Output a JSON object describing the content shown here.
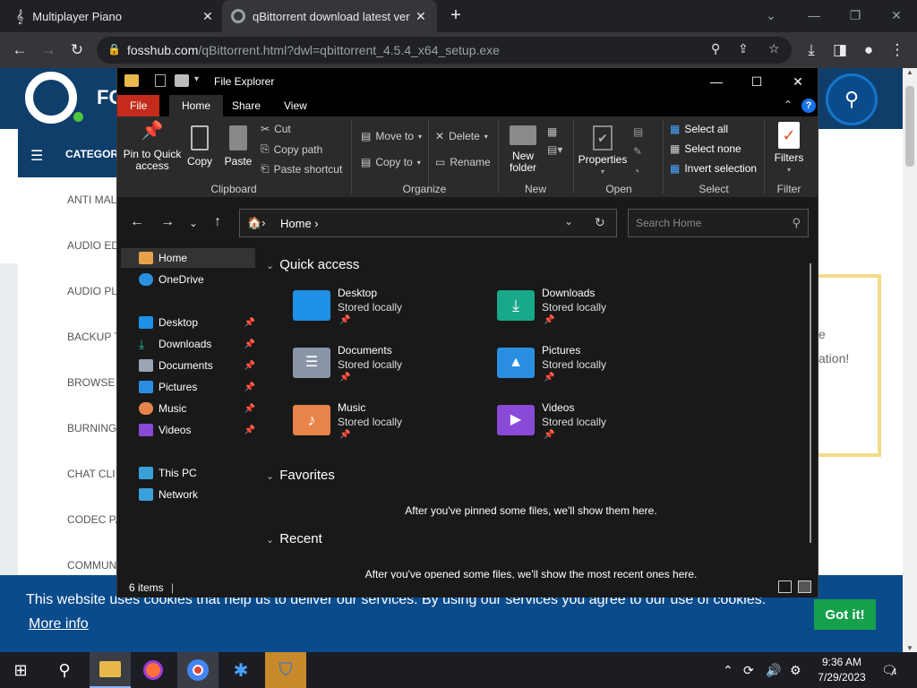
{
  "browser": {
    "tabs": [
      {
        "title": "Multiplayer Piano"
      },
      {
        "title": "qBittorrent download latest versi"
      }
    ],
    "url_host": "fosshub.com",
    "url_path": "/qBittorrent.html?dwl=qbittorrent_4.5.4_x64_setup.exe"
  },
  "website": {
    "brand": "FO",
    "categories_label": "CATEGORI",
    "categories": [
      "ANTI MAL",
      "AUDIO ED",
      "AUDIO PL",
      "BACKUP T",
      "BROWSE",
      "BURNING",
      "CHAT CLI",
      "CODEC PA",
      "COMMUN"
    ],
    "promo_line1": "e",
    "promo_line2": "ation!",
    "cookie_message": "This website uses cookies that help us to deliver our services. By using our services you agree to our use of cookies.",
    "more_info": "More info",
    "got_it": "Got it!"
  },
  "explorer": {
    "title": "File Explorer",
    "ribbon_tabs": {
      "file": "File",
      "home": "Home",
      "share": "Share",
      "view": "View"
    },
    "ribbon": {
      "pin": "Pin to Quick access",
      "copy": "Copy",
      "paste": "Paste",
      "cut": "Cut",
      "copy_path": "Copy path",
      "paste_shortcut": "Paste shortcut",
      "move_to": "Move to",
      "copy_to": "Copy to",
      "delete": "Delete",
      "rename": "Rename",
      "new_folder": "New folder",
      "properties": "Properties",
      "select_all": "Select all",
      "select_none": "Select none",
      "invert_selection": "Invert selection",
      "filters": "Filters",
      "groups": {
        "clipboard": "Clipboard",
        "organize": "Organize",
        "new": "New",
        "open": "Open",
        "select": "Select",
        "filter": "Filter"
      }
    },
    "address": "Home",
    "search_placeholder": "Search Home",
    "nav": {
      "home": "Home",
      "onedrive": "OneDrive",
      "desktop": "Desktop",
      "downloads": "Downloads",
      "documents": "Documents",
      "pictures": "Pictures",
      "music": "Music",
      "videos": "Videos",
      "this_pc": "This PC",
      "network": "Network"
    },
    "sections": {
      "quick_access": "Quick access",
      "favorites": "Favorites",
      "recent": "Recent"
    },
    "tiles": [
      {
        "name": "Desktop",
        "status": "Stored locally",
        "color": "#1e90e6"
      },
      {
        "name": "Downloads",
        "status": "Stored locally",
        "color": "#18a88a"
      },
      {
        "name": "Documents",
        "status": "Stored locally",
        "color": "#8a95a8"
      },
      {
        "name": "Pictures",
        "status": "Stored locally",
        "color": "#2a8fe0"
      },
      {
        "name": "Music",
        "status": "Stored locally",
        "color": "#e8844a"
      },
      {
        "name": "Videos",
        "status": "Stored locally",
        "color": "#8a4ad8"
      }
    ],
    "favorites_empty": "After you've pinned some files, we'll show them here.",
    "recent_empty": "After you've opened some files, we'll show the most recent ones here.",
    "status_items": "6 items"
  },
  "taskbar": {
    "time": "9:36 AM",
    "date": "7/29/2023",
    "notification_count": "4"
  }
}
